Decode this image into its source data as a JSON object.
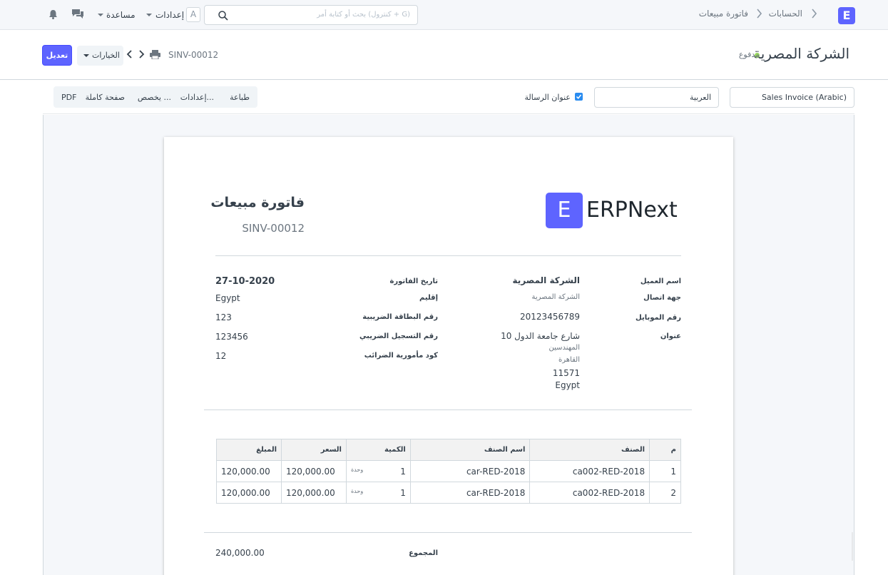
{
  "navbar": {
    "logo_letter": "E",
    "breadcrumb_accounts": "الحسابات",
    "breadcrumb_sales_invoice": "فاتورة مبيعات",
    "search_placeholder": "بحث أو كتابة أمر (كنترول + G)",
    "avatar_letter": "A",
    "settings_label": "إعدادات",
    "help_label": "مساعدة"
  },
  "page_head": {
    "title": "الشركة المصرية",
    "status": "مدفوع",
    "doc_name": "SINV-00012",
    "edit_button": "تعديل",
    "menu_button": "الخيارات"
  },
  "toolbar": {
    "print_format": "Sales Invoice (Arabic)",
    "language": "العربية",
    "letterhead_label": "عنوان الرسالة",
    "letterhead_checked": true,
    "print_button": "طباعة",
    "settings_button": "إعدادات...",
    "customize_button": "يخصص ...",
    "fullpage_button": "صفحة كاملة",
    "pdf_button": "PDF"
  },
  "invoice": {
    "brand_letter": "E",
    "brand_name": "ERPNext",
    "title": "فاتورة مبيعات",
    "number": "SINV-00012",
    "labels": {
      "customer_name": "اسم العميل",
      "contact": "جهة اتصال",
      "mobile": "رقم الموبايل",
      "address": "عنوان",
      "invoice_date": "تاريخ الفاتورة",
      "territory": "إقليم",
      "tax_card": "رقم البطاقة الضريبية",
      "tax_registration": "رقم التسجيل الضريبي",
      "tax_office_code": "كود مأمورية الضرائب",
      "total": "المجموع"
    },
    "values": {
      "customer_name": "الشركة المصرية",
      "contact": "الشركة المصرية",
      "mobile": "20123456789",
      "address_line1": "10 شارع جامعة الدول",
      "address_line2": "المهندسين",
      "address_line3": "القاهرة",
      "address_line4": "11571",
      "address_line5": "Egypt",
      "invoice_date": "27-10-2020",
      "territory": "Egypt",
      "tax_card": "123",
      "tax_registration": "123456",
      "tax_office_code": "12",
      "total": "240,000.00"
    },
    "table": {
      "headers": [
        "م",
        "الصنف",
        "اسم الصنف",
        "الكمية",
        "السعر",
        "المبلغ"
      ],
      "rows": [
        {
          "idx": "1",
          "item_code": "ca002-RED-2018",
          "item_name": "car-RED-2018",
          "qty": "1",
          "uom": "وحدة",
          "rate": "120,000.00",
          "amount": "120,000.00"
        },
        {
          "idx": "2",
          "item_code": "ca002-RED-2018",
          "item_name": "car-RED-2018",
          "qty": "1",
          "uom": "وحدة",
          "rate": "120,000.00",
          "amount": "120,000.00"
        }
      ]
    }
  },
  "colors": {
    "primary": "#5e64ff",
    "status_dot": "#98d85b",
    "checkbox": "#2a8cf0"
  }
}
